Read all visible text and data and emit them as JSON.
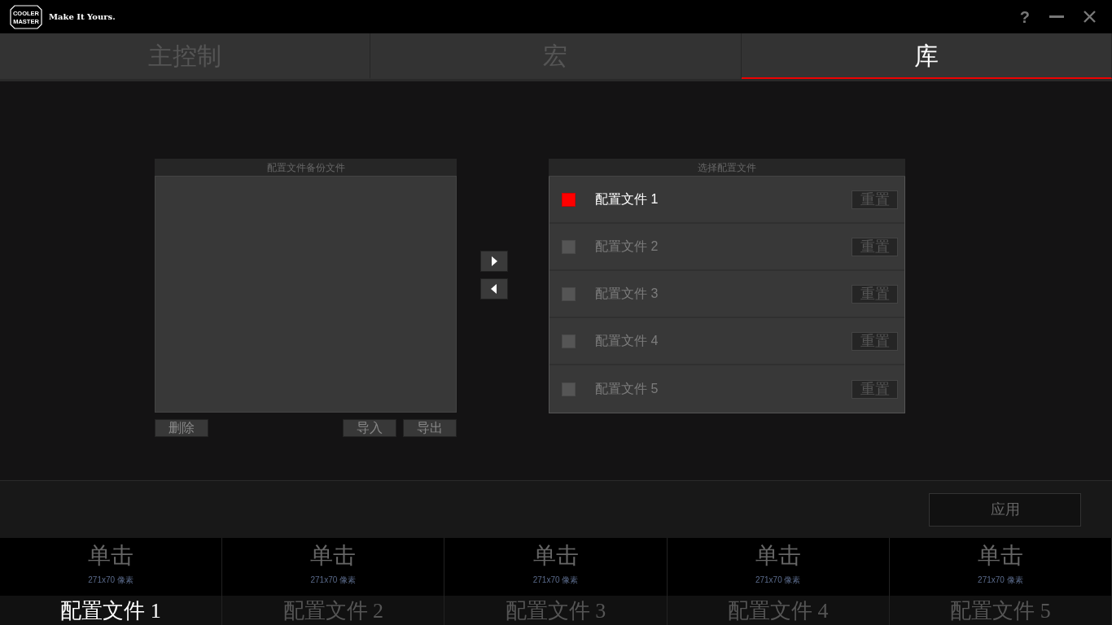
{
  "app": {
    "logo_lines": [
      "COOLER",
      "MASTER"
    ],
    "tagline": "Make It Yours.",
    "help": "?"
  },
  "tabs": [
    {
      "label": "主控制",
      "selected": false
    },
    {
      "label": "宏",
      "selected": false
    },
    {
      "label": "库",
      "selected": true
    }
  ],
  "backup_panel": {
    "title": "配置文件备份文件",
    "buttons": [
      "删除",
      "导入",
      "导出"
    ]
  },
  "profile_panel": {
    "title": "选择配置文件",
    "profiles": [
      {
        "label": "配置文件 1",
        "selected": true,
        "reset": "重置"
      },
      {
        "label": "配置文件 2",
        "selected": false,
        "reset": "重置"
      },
      {
        "label": "配置文件 3",
        "selected": false,
        "reset": "重置"
      },
      {
        "label": "配置文件 4",
        "selected": false,
        "reset": "重置"
      },
      {
        "label": "配置文件 5",
        "selected": false,
        "reset": "重置"
      }
    ]
  },
  "apply": "应用",
  "profile_strip": [
    {
      "action": "单击",
      "size": "271x70 像素",
      "label": "配置文件 1",
      "selected": true
    },
    {
      "action": "单击",
      "size": "271x70 像素",
      "label": "配置文件 2",
      "selected": false
    },
    {
      "action": "单击",
      "size": "271x70 像素",
      "label": "配置文件 3",
      "selected": false
    },
    {
      "action": "单击",
      "size": "271x70 像素",
      "label": "配置文件 4",
      "selected": false
    },
    {
      "action": "单击",
      "size": "271x70 像素",
      "label": "配置文件 5",
      "selected": false
    }
  ]
}
